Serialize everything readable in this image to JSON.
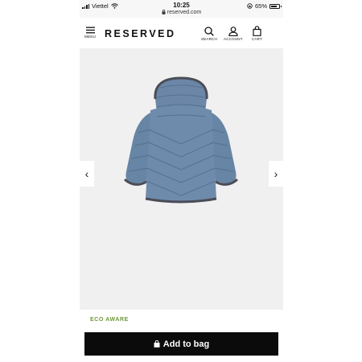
{
  "status_bar": {
    "carrier": "Viettel",
    "time": "10:25",
    "url": "reserved.com",
    "battery": "65%"
  },
  "header": {
    "menu_label": "MENU",
    "logo": "RESERVED",
    "search_label": "SEARCH",
    "account_label": "ACCOUNT",
    "cart_label": "CART"
  },
  "gallery": {
    "image_description": "blue quilted puffer jacket with hood, back view",
    "colors": {
      "jacket": "#6b86a6",
      "trim": "#4a4d57",
      "background": "#f0f0f0"
    }
  },
  "product": {
    "badge": "ECO AWARE",
    "add_to_bag": "Add to bag"
  },
  "colors": {
    "badge": "#6f9a3a",
    "button": "#0b0b0b"
  }
}
